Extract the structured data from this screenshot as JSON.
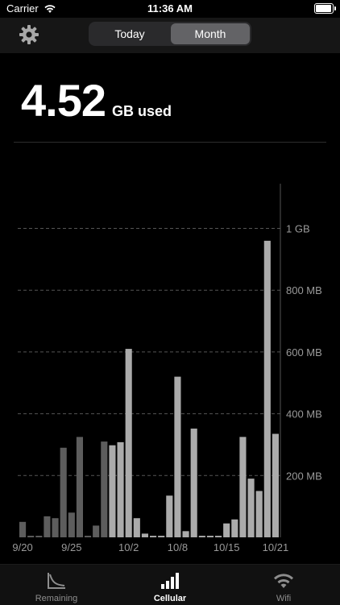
{
  "status_bar": {
    "carrier": "Carrier",
    "time": "11:36 AM"
  },
  "nav": {
    "segments": [
      {
        "label": "Today",
        "selected": false
      },
      {
        "label": "Month",
        "selected": true
      }
    ]
  },
  "usage": {
    "value": "4.52",
    "unit": "GB used"
  },
  "chart_data": {
    "type": "bar",
    "title": "",
    "xlabel": "",
    "ylabel": "",
    "ylim": [
      0,
      1.15
    ],
    "y_ticks": [
      {
        "value": 1.0,
        "label": "1 GB"
      },
      {
        "value": 0.8,
        "label": "800 MB"
      },
      {
        "value": 0.6,
        "label": "600 MB"
      },
      {
        "value": 0.4,
        "label": "400 MB"
      },
      {
        "value": 0.2,
        "label": "200 MB"
      }
    ],
    "x_tick_labels": [
      {
        "label": "9/20",
        "index": 0
      },
      {
        "label": "9/25",
        "index": 6
      },
      {
        "label": "10/2",
        "index": 13
      },
      {
        "label": "10/8",
        "index": 19
      },
      {
        "label": "10/15",
        "index": 25
      },
      {
        "label": "10/21",
        "index": 31
      }
    ],
    "grid": true,
    "values": [
      0.05,
      0.005,
      0.005,
      0.068,
      0.062,
      0.29,
      0.08,
      0.325,
      0.005,
      0.038,
      0.31,
      0.298,
      0.308,
      0.61,
      0.062,
      0.012,
      0.005,
      0.005,
      0.135,
      0.52,
      0.02,
      0.352,
      0.005,
      0.005,
      0.005,
      0.045,
      0.058,
      0.325,
      0.19,
      0.15,
      0.96,
      0.335
    ],
    "colors": {
      "dim": "#5d5d5d",
      "bright": "#ababab",
      "grid": "#555555",
      "axis_text": "#9a9a9a"
    },
    "dim_count": 11
  },
  "tabs": [
    {
      "label": "Remaining",
      "icon": "remaining-graph-icon",
      "selected": false
    },
    {
      "label": "Cellular",
      "icon": "cellular-signal-icon",
      "selected": true
    },
    {
      "label": "Wifi",
      "icon": "wifi-icon",
      "selected": false
    }
  ]
}
